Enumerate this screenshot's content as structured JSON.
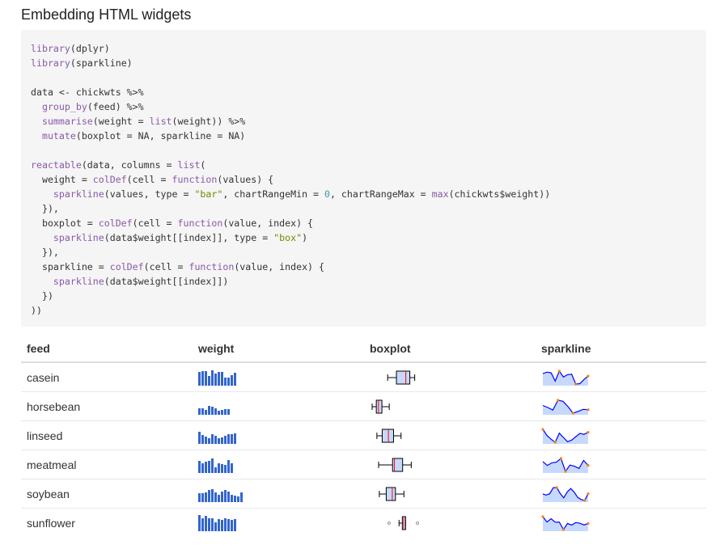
{
  "heading": "Embedding HTML widgets",
  "code_lines": [
    "library(dplyr)",
    "library(sparkline)",
    "",
    "data <- chickwts %>%",
    "  group_by(feed) %>%",
    "  summarise(weight = list(weight)) %>%",
    "  mutate(boxplot = NA, sparkline = NA)",
    "",
    "reactable(data, columns = list(",
    "  weight = colDef(cell = function(values) {",
    "    sparkline(values, type = \"bar\", chartRangeMin = 0, chartRangeMax = max(chickwts$weight))",
    "  }),",
    "  boxplot = colDef(cell = function(value, index) {",
    "    sparkline(data$weight[[index]], type = \"box\")",
    "  }),",
    "  sparkline = colDef(cell = function(value, index) {",
    "    sparkline(data$weight[[index]])",
    "  })",
    "))"
  ],
  "table": {
    "columns": [
      "feed",
      "weight",
      "boxplot",
      "sparkline"
    ],
    "rows": [
      {
        "feed": "casein",
        "weight": [
          368,
          390,
          379,
          260,
          404,
          318,
          352,
          359,
          216,
          222,
          283,
          332
        ],
        "boxplot": {
          "min": 216,
          "q1": 277,
          "median": 342,
          "q3": 370,
          "max": 404,
          "outliers": []
        }
      },
      {
        "feed": "horsebean",
        "weight": [
          179,
          160,
          136,
          227,
          217,
          168,
          108,
          124,
          143,
          140
        ],
        "boxplot": {
          "min": 108,
          "q1": 137,
          "median": 152,
          "q3": 176,
          "max": 227,
          "outliers": []
        }
      },
      {
        "feed": "linseed",
        "weight": [
          309,
          229,
          181,
          141,
          260,
          203,
          148,
          169,
          213,
          257,
          244,
          271
        ],
        "boxplot": {
          "min": 141,
          "q1": 178,
          "median": 221,
          "q3": 257,
          "max": 309,
          "outliers": []
        }
      },
      {
        "feed": "meatmeal",
        "weight": [
          325,
          257,
          303,
          315,
          380,
          153,
          263,
          242,
          206,
          344,
          258
        ],
        "boxplot": {
          "min": 153,
          "q1": 250,
          "median": 263,
          "q3": 320,
          "max": 380,
          "outliers": []
        }
      },
      {
        "feed": "soybean",
        "weight": [
          243,
          230,
          248,
          327,
          329,
          250,
          193,
          271,
          316,
          267,
          199,
          171,
          158,
          248
        ],
        "boxplot": {
          "min": 158,
          "q1": 206,
          "median": 248,
          "q3": 270,
          "max": 329,
          "outliers": []
        }
      },
      {
        "feed": "sunflower",
        "weight": [
          423,
          340,
          392,
          339,
          341,
          226,
          320,
          295,
          334,
          322,
          297,
          318
        ],
        "boxplot": {
          "min": 295,
          "q1": 318,
          "median": 328,
          "q3": 341,
          "max": 341,
          "outliers": [
            226,
            423
          ]
        }
      }
    ]
  },
  "scale": {
    "bar_max": 423,
    "box_min": 108,
    "box_max": 423
  },
  "colors": {
    "bar": "#3366cc",
    "box_fill": "#c6d9fd",
    "box_stroke": "#000000",
    "median": "#ff0000",
    "line": "#0000ff",
    "area": "#c6d9fd",
    "spot_max": "#ff8000",
    "spot_min": "#ff8000",
    "spot_end": "#ff8000"
  }
}
